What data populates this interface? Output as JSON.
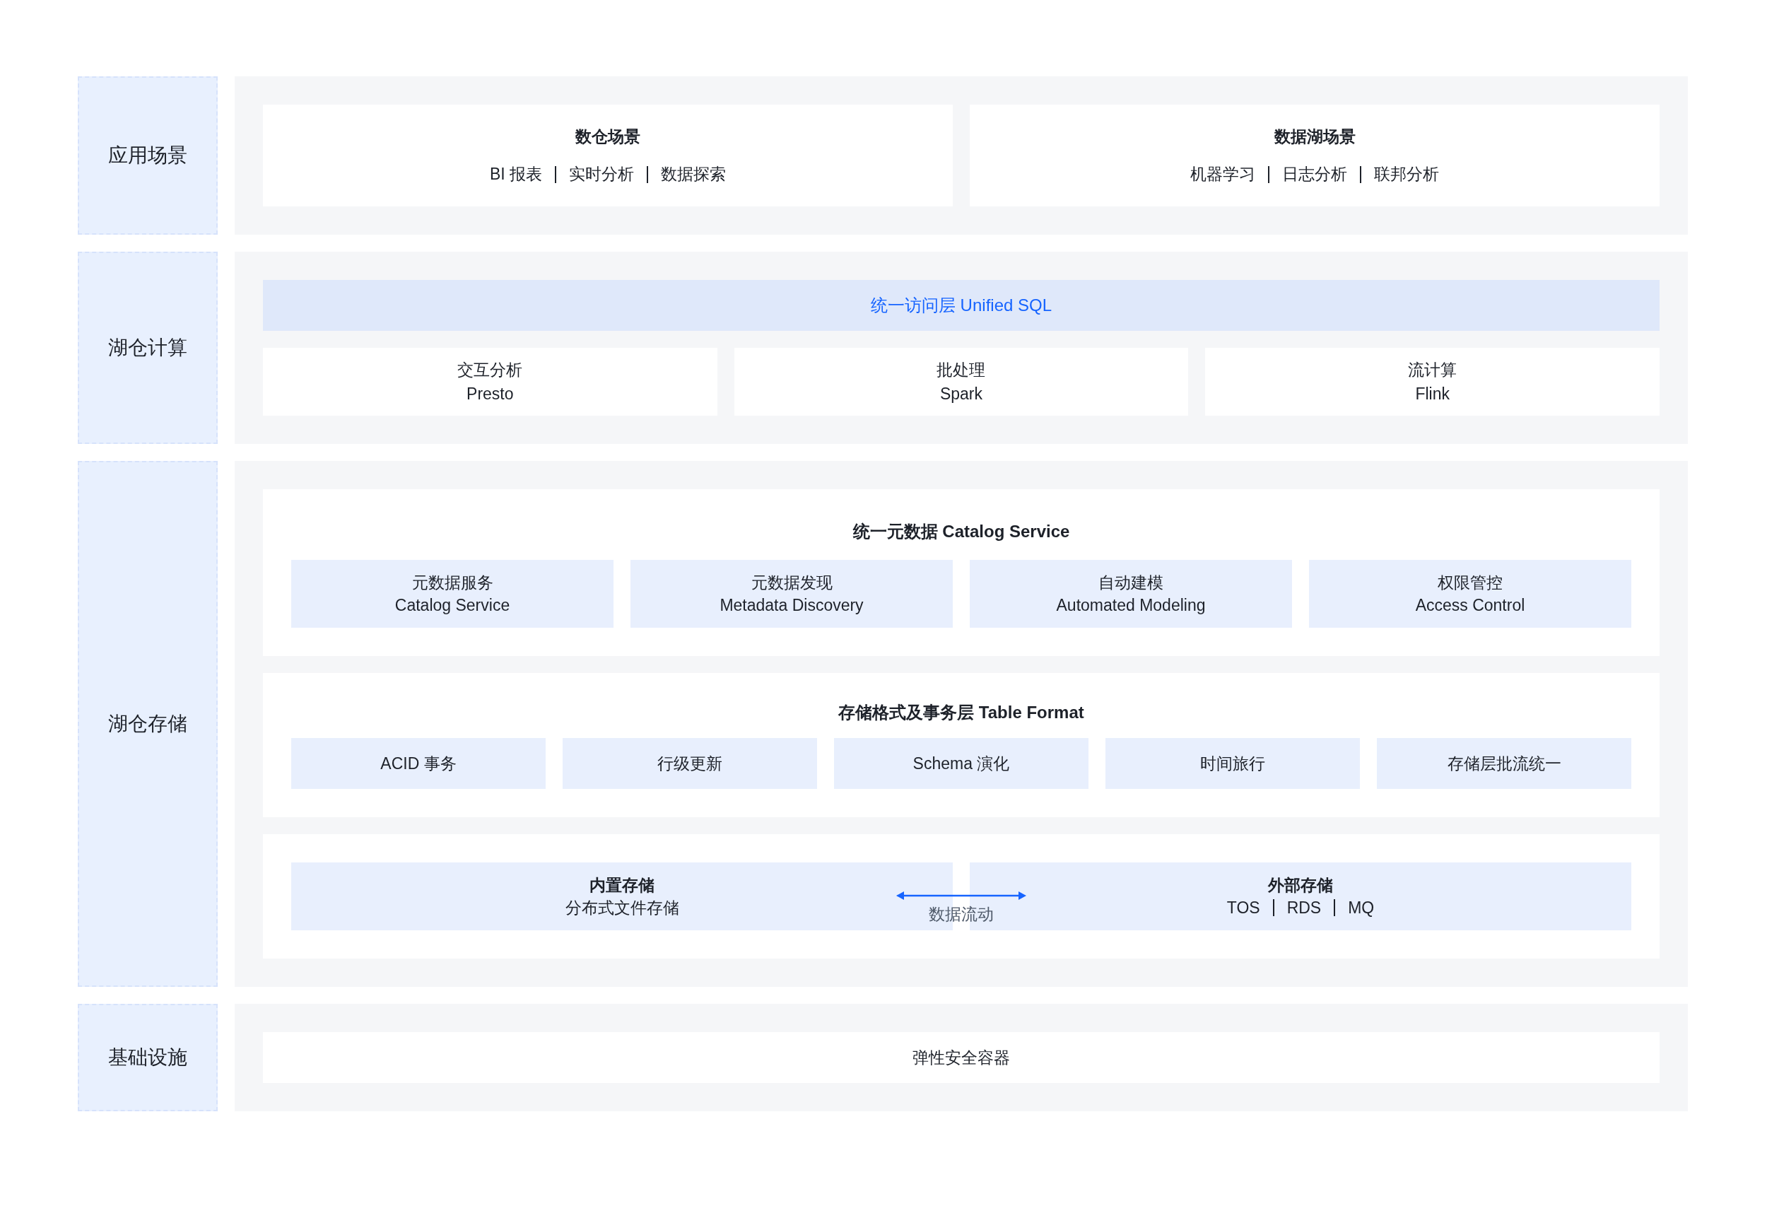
{
  "layers": [
    {
      "kind": "scenarios",
      "label": "应用场景",
      "cards": [
        {
          "title": "数仓场景",
          "items": [
            "BI 报表",
            "实时分析",
            "数据探索"
          ]
        },
        {
          "title": "数据湖场景",
          "items": [
            "机器学习",
            "日志分析",
            "联邦分析"
          ]
        }
      ]
    },
    {
      "kind": "compute",
      "label": "湖仓计算",
      "banner": "统一访问层 Unified SQL",
      "engines": [
        {
          "name": "交互分析",
          "product": "Presto"
        },
        {
          "name": "批处理",
          "product": "Spark"
        },
        {
          "name": "流计算",
          "product": "Flink"
        }
      ]
    },
    {
      "kind": "storage",
      "label": "湖仓存储",
      "sections": [
        {
          "kind": "catalog",
          "title": "统一元数据 Catalog Service",
          "items": [
            {
              "name": "元数据服务",
              "en": "Catalog Service"
            },
            {
              "name": "元数据发现",
              "en": "Metadata Discovery"
            },
            {
              "name": "自动建模",
              "en": "Automated Modeling"
            },
            {
              "name": "权限管控",
              "en": "Access Control"
            }
          ]
        },
        {
          "kind": "format",
          "title": "存储格式及事务层 Table Format",
          "items": [
            "ACID 事务",
            "行级更新",
            "Schema 演化",
            "时间旅行",
            "存储层批流统一"
          ]
        },
        {
          "kind": "stores",
          "stores": [
            {
              "title": "内置存储",
              "items": [
                "分布式文件存储"
              ]
            },
            {
              "title": "外部存储",
              "items": [
                "TOS",
                "RDS",
                "MQ"
              ]
            }
          ],
          "flow": "数据流动"
        }
      ]
    },
    {
      "kind": "infra",
      "label": "基础设施",
      "card": "弹性安全容器"
    }
  ]
}
